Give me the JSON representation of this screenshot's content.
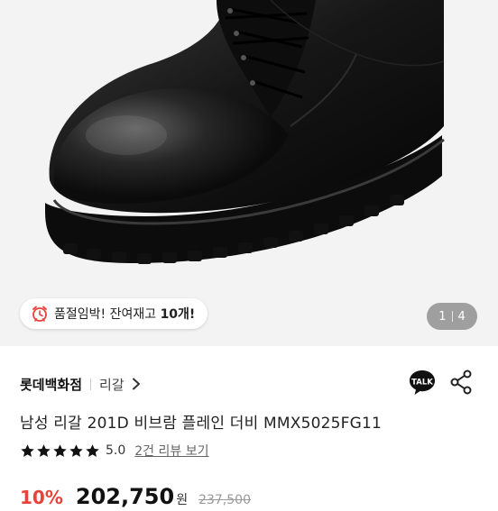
{
  "product_image": {
    "alt_icon": "shoe-photo"
  },
  "stock_notice": {
    "prefix": "품절임박! 잔여재고 ",
    "count": "10개!",
    "icon": "alarm-clock-icon"
  },
  "gallery": {
    "current": "1",
    "total": "4"
  },
  "store": {
    "name": "롯데백화점",
    "brand": "리갈",
    "talk_icon": "talk-chat-icon",
    "share_icon": "share-icon"
  },
  "product": {
    "title": "남성 리갈 201D 비브람 플레인 더비 MMX5025FG11"
  },
  "rating": {
    "score": "5.0",
    "stars": 5,
    "reviews_label": "2건 리뷰 보기"
  },
  "price": {
    "discount": "10%",
    "sale": "202,750",
    "unit": "원",
    "original": "237,500"
  },
  "colors": {
    "accent_red": "#e8433a",
    "star": "#111111"
  }
}
